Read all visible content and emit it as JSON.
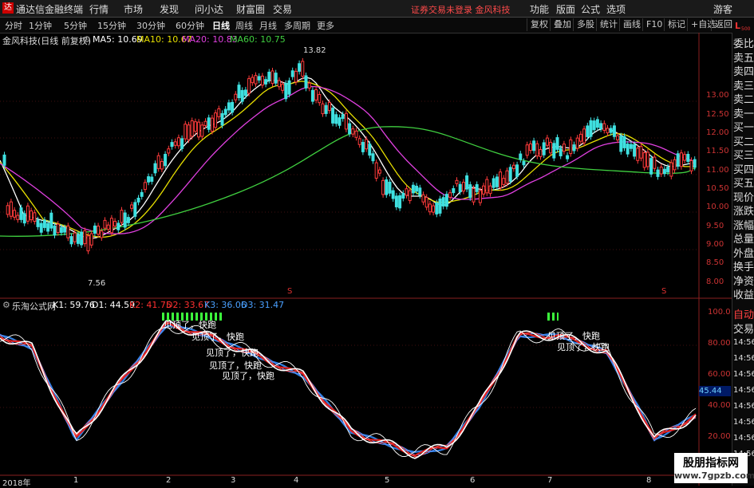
{
  "titlebar": {
    "app_title": "通达信金融终端",
    "menu": [
      "行情",
      "市场",
      "发现",
      "问小达",
      "财富圈",
      "交易"
    ],
    "notice": "证券交易未登录  金风科技",
    "right_menu": [
      "功能",
      "版面",
      "公式",
      "选项"
    ],
    "guest": "游客"
  },
  "toolbar": {
    "periods": [
      "分时",
      "1分钟",
      "5分钟",
      "15分钟",
      "30分钟",
      "60分钟",
      "日线",
      "周线",
      "月线",
      "多周期",
      "更多"
    ],
    "active_period": "日线",
    "right_buttons": [
      "复权",
      "叠加",
      "多股",
      "统计",
      "画线",
      "F10",
      "标记",
      "+自选",
      "返回"
    ]
  },
  "main_chart": {
    "stock": "金风科技(日线 前复权)",
    "ma_labels": [
      {
        "text": "MA5: 10.69",
        "color": "#ffffff"
      },
      {
        "text": "MA10: 10.67",
        "color": "#e8e000"
      },
      {
        "text": "MA20: 10.83",
        "color": "#e040e0"
      },
      {
        "text": "MA60: 10.75",
        "color": "#40d040"
      }
    ],
    "high_label": "13.82",
    "low_label": "7.56",
    "price_axis": [
      "13.00",
      "12.50",
      "12.00",
      "11.50",
      "11.00",
      "10.50",
      "10.00",
      "9.50",
      "9.00",
      "8.50",
      "8.00"
    ],
    "s_marker": "S"
  },
  "indicator": {
    "name": "乐淘公式网",
    "values": [
      {
        "text": "K1: 59.76",
        "color": "#ffffff"
      },
      {
        "text": "D1: 44.59",
        "color": "#ffffff"
      },
      {
        "text": "K2: 41.75",
        "color": "#ff3030"
      },
      {
        "text": "D2: 33.67",
        "color": "#ff3030"
      },
      {
        "text": "K3: 36.06",
        "color": "#4aa0ff"
      },
      {
        "text": "D3: 31.47",
        "color": "#4aa0ff"
      }
    ],
    "axis": [
      "100.0",
      "80.00",
      "60.00",
      "40.00",
      "20.00"
    ],
    "current_value": "45.44",
    "warning_text": "见顶了，快跑",
    "warning_text2": "见顶了，快跑"
  },
  "time_axis": [
    "2018年",
    "1",
    "2",
    "3",
    "4",
    "5",
    "6",
    "7",
    "8"
  ],
  "right_panel": {
    "top_badge": "L",
    "top_badge_num": "500",
    "items": [
      "委比",
      "卖五",
      "卖四",
      "卖三",
      "卖二",
      "卖一",
      "买一",
      "买二",
      "买三",
      "买四",
      "买五",
      "现价",
      "涨跌",
      "涨幅",
      "总量",
      "外盘",
      "换手",
      "净资",
      "收益"
    ],
    "lower_items": [
      "自动",
      "交易"
    ],
    "times": [
      "14:56",
      "14:56",
      "14:56",
      "14:56",
      "14:56",
      "14:56",
      "14:56",
      "14:56"
    ]
  },
  "watermark": {
    "line1": "股朋指标网",
    "line2": "www.7gpzb.com"
  },
  "chart_data": {
    "type": "candlestick",
    "title": "金风科技(日线 前复权)",
    "ylim": [
      7.5,
      14.0
    ],
    "note_high": 13.82,
    "note_low": 7.56
  }
}
